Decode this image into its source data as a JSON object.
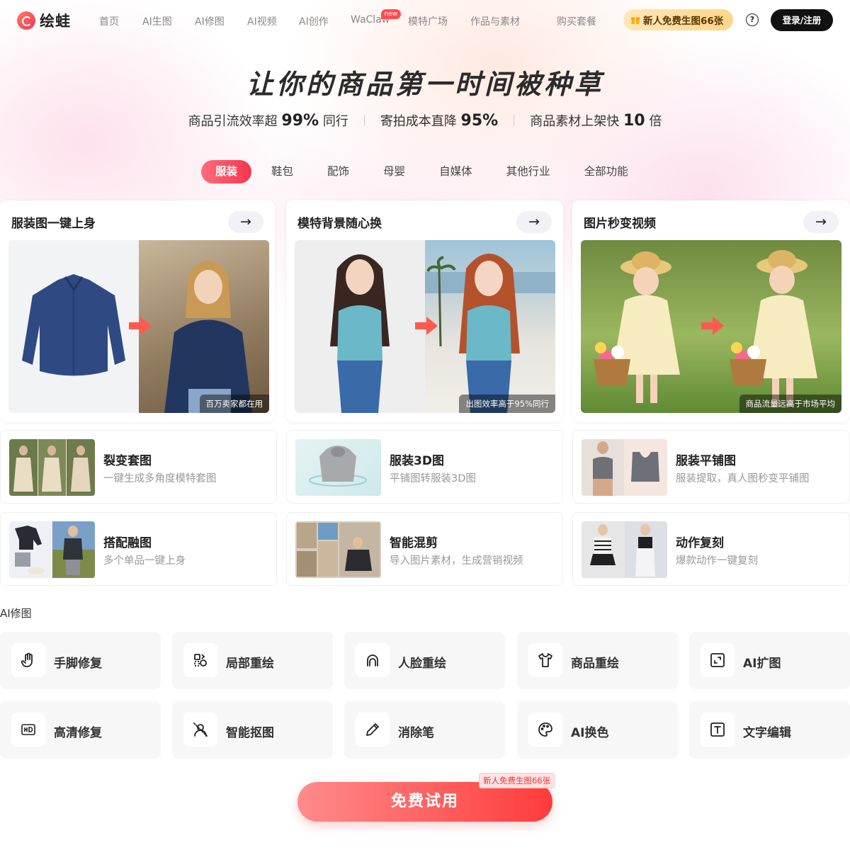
{
  "header": {
    "logo_text": "绘蛙",
    "nav": [
      {
        "label": "首页",
        "x": 0
      },
      {
        "label": "AI生图"
      },
      {
        "label": "AI修图"
      },
      {
        "label": "AI视频"
      },
      {
        "label": "AI创作"
      },
      {
        "label": "WaClaw",
        "badge": "new"
      },
      {
        "label": "模特广场"
      },
      {
        "label": "作品与素材"
      },
      {
        "label": "购买套餐"
      }
    ],
    "promo": "新人免费生图66张",
    "help": "?",
    "login": "登录/注册"
  },
  "hero": {
    "title": "让你的商品第一时间被种草",
    "stats": [
      {
        "pre": "商品引流效率超",
        "num": "99%",
        "post": "同行"
      },
      {
        "pre": "寄拍成本直降",
        "num": "95%",
        "post": ""
      },
      {
        "pre": "商品素材上架快",
        "num": "10",
        "post": "倍"
      }
    ]
  },
  "tabs": [
    "服装",
    "鞋包",
    "配饰",
    "母婴",
    "自媒体",
    "其他行业",
    "全部功能"
  ],
  "feature_cards": [
    {
      "title": "服装图一键上身",
      "tag": "百万卖家都在用"
    },
    {
      "title": "模特背景随心换",
      "tag": "出图效率高于95%同行"
    },
    {
      "title": "图片秒变视频",
      "tag": "商品流量远高于市场平均"
    }
  ],
  "tool_cards": [
    {
      "title": "裂变套图",
      "desc": "一键生成多角度模特套图"
    },
    {
      "title": "服装3D图",
      "desc": "平铺图转服装3D图"
    },
    {
      "title": "服装平铺图",
      "desc": "服装提取，真人图秒变平铺图"
    },
    {
      "title": "搭配融图",
      "desc": "多个单品一键上身"
    },
    {
      "title": "智能混剪",
      "desc": "导入图片素材，生成营销视频"
    },
    {
      "title": "动作复刻",
      "desc": "爆款动作一键复刻"
    }
  ],
  "ai_edit": {
    "label": "AI修图",
    "items": [
      {
        "label": "手脚修复",
        "icon": "hand-icon"
      },
      {
        "label": "局部重绘",
        "icon": "shapes-icon"
      },
      {
        "label": "人脸重绘",
        "icon": "face-icon"
      },
      {
        "label": "商品重绘",
        "icon": "tshirt-icon"
      },
      {
        "label": "AI扩图",
        "icon": "expand-icon"
      },
      {
        "label": "高清修复",
        "icon": "hd-icon"
      },
      {
        "label": "智能抠图",
        "icon": "cutout-icon"
      },
      {
        "label": "消除笔",
        "icon": "pen-icon"
      },
      {
        "label": "AI换色",
        "icon": "palette-icon"
      },
      {
        "label": "文字编辑",
        "icon": "text-icon"
      }
    ]
  },
  "cta": {
    "label": "免费试用",
    "badge": "新人免费生图66张"
  }
}
